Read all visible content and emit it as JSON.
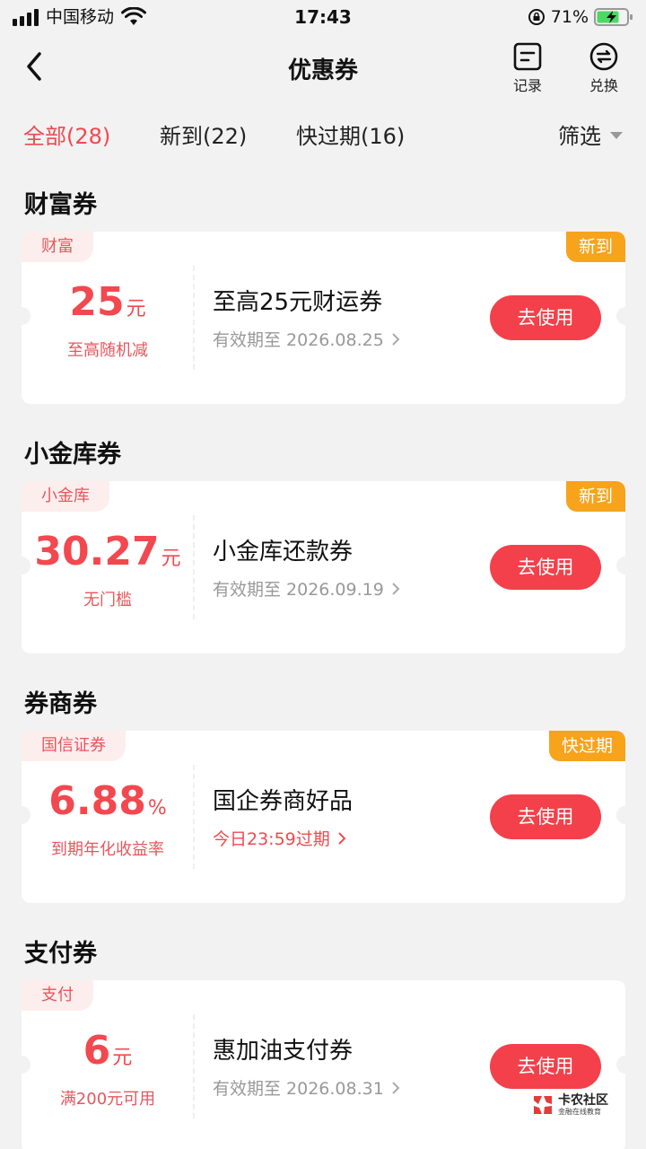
{
  "status_bar": {
    "carrier": "中国移动",
    "time": "17:43",
    "battery_percent": "71%"
  },
  "nav": {
    "title": "优惠券",
    "record_label": "记录",
    "exchange_label": "兑换"
  },
  "tabs": [
    {
      "label": "全部(28)",
      "active": true
    },
    {
      "label": "新到(22)",
      "active": false
    },
    {
      "label": "快过期(16)",
      "active": false
    }
  ],
  "filter_label": "筛选",
  "sections": [
    {
      "title": "财富券",
      "coupon": {
        "tag": "财富",
        "badge": "新到",
        "amount": "25",
        "unit": "元",
        "condition": "至高随机减",
        "name": "至高25元财运券",
        "validity": "有效期至 2026.08.25",
        "button": "去使用"
      }
    },
    {
      "title": "小金库券",
      "coupon": {
        "tag": "小金库",
        "badge": "新到",
        "amount": "30.27",
        "unit": "元",
        "condition": "无门槛",
        "name": "小金库还款券",
        "validity": "有效期至 2026.09.19",
        "button": "去使用"
      }
    },
    {
      "title": "券商券",
      "coupon": {
        "tag": "国信证券",
        "badge": "快过期",
        "amount": "6.88",
        "unit": "%",
        "condition": "到期年化收益率",
        "name": "国企券商好品",
        "validity": "今日23:59过期",
        "button": "去使用"
      }
    },
    {
      "title": "支付券",
      "coupon": {
        "tag": "支付",
        "amount": "6",
        "unit": "元",
        "condition": "满200元可用",
        "name": "惠加油支付券",
        "validity": "有效期至 2026.08.31",
        "button": "去使用"
      }
    }
  ],
  "watermark": {
    "name": "卡农社区",
    "slogan": "金融在线教育"
  },
  "colors": {
    "accent": "#f2484f",
    "badge": "#f7a31c",
    "tag_bg": "#fdeeee",
    "background": "#f2f2f2"
  }
}
